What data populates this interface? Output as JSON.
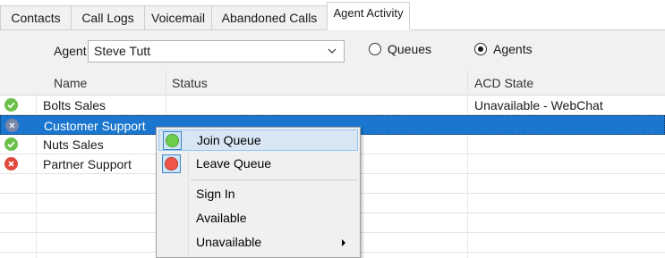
{
  "tabs": [
    {
      "label": "Contacts"
    },
    {
      "label": "Call Logs"
    },
    {
      "label": "Voicemail"
    },
    {
      "label": "Abandoned Calls"
    },
    {
      "label": "Agent Activity",
      "active": true
    }
  ],
  "toolbar": {
    "agent_label": "Agent",
    "agent_value": "Steve Tutt",
    "radio_queues": "Queues",
    "radio_agents": "Agents",
    "selected_radio": "Agents"
  },
  "grid": {
    "columns": {
      "name": "Name",
      "status": "Status",
      "acd_state": "ACD State"
    },
    "rows": [
      {
        "status_icon": "check-circle-icon",
        "name": "Bolts Sales",
        "acd_state": "Unavailable - WebChat"
      },
      {
        "status_icon": "x-circle-icon",
        "name": "Customer Support",
        "acd_state": "",
        "selected": true
      },
      {
        "status_icon": "check-circle-icon",
        "name": "Nuts Sales",
        "acd_state": ""
      },
      {
        "status_icon": "x-circle-icon",
        "name": "Partner Support",
        "acd_state": ""
      }
    ]
  },
  "context_menu": {
    "items": [
      {
        "label": "Join Queue",
        "icon": "green-circle-icon"
      },
      {
        "label": "Leave Queue",
        "icon": "red-circle-icon"
      },
      {
        "label": "Sign In"
      },
      {
        "label": "Available"
      },
      {
        "label": "Unavailable",
        "has_submenu": true
      }
    ]
  },
  "colors": {
    "selection": "#1a76cf",
    "status_green": "#6cc04a",
    "status_red": "#e2483d",
    "status_gray_blue": "#7a86a6",
    "menu_green": "#6ccf4a",
    "menu_red": "#f0574a"
  }
}
